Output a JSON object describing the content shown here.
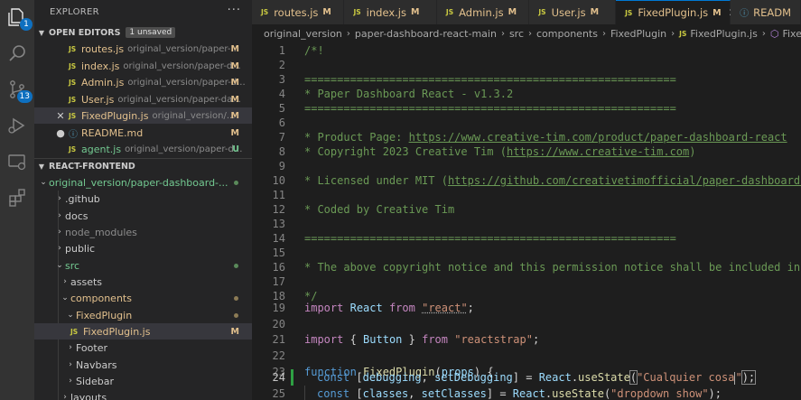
{
  "activity": {
    "scm_badge": "13",
    "explorer_badge": "1"
  },
  "sidebar": {
    "title": "EXPLORER",
    "more": "···",
    "open_editors": {
      "label": "OPEN EDITORS",
      "badge": "1 unsaved",
      "items": [
        {
          "name": "routes.js",
          "path": "original_version/paper-...",
          "status": "M",
          "type": "js"
        },
        {
          "name": "index.js",
          "path": "original_version/paper-d...",
          "status": "M",
          "type": "js"
        },
        {
          "name": "Admin.js",
          "path": "original_version/paper-d...",
          "status": "M",
          "type": "js"
        },
        {
          "name": "User.js",
          "path": "original_version/paper-da...",
          "status": "M",
          "type": "js"
        },
        {
          "name": "FixedPlugin.js",
          "path": "original_version/...",
          "status": "M",
          "type": "js"
        },
        {
          "name": "README.md",
          "path": "",
          "status": "M",
          "type": "info"
        },
        {
          "name": "agent.js",
          "path": "original_version/paper-d...",
          "status": "U",
          "type": "js"
        }
      ]
    },
    "project": {
      "label": "REACT-FRONTEND",
      "tree": [
        {
          "name": "original_version/paper-dashboard-...",
          "level": 0,
          "open": true
        },
        {
          "name": ".github",
          "level": 1,
          "open": false
        },
        {
          "name": "docs",
          "level": 1,
          "open": false
        },
        {
          "name": "node_modules",
          "level": 1,
          "open": false
        },
        {
          "name": "public",
          "level": 1,
          "open": false
        },
        {
          "name": "src",
          "level": 1,
          "open": true
        },
        {
          "name": "assets",
          "level": 2,
          "open": false
        },
        {
          "name": "components",
          "level": 2,
          "open": true
        },
        {
          "name": "FixedPlugin",
          "level": 3,
          "open": true
        },
        {
          "name": "FixedPlugin.js",
          "level": 4,
          "file": true,
          "status": "M"
        },
        {
          "name": "Footer",
          "level": 3,
          "open": false
        },
        {
          "name": "Navbars",
          "level": 3,
          "open": false
        },
        {
          "name": "Sidebar",
          "level": 3,
          "open": false
        },
        {
          "name": "layouts",
          "level": 2,
          "open": false
        }
      ]
    }
  },
  "tabs": [
    {
      "name": "routes.js",
      "mark": "M",
      "type": "js"
    },
    {
      "name": "index.js",
      "mark": "M",
      "type": "js"
    },
    {
      "name": "Admin.js",
      "mark": "M",
      "type": "js"
    },
    {
      "name": "User.js",
      "mark": "M",
      "type": "js"
    },
    {
      "name": "FixedPlugin.js",
      "mark": "M",
      "type": "js",
      "active": true
    },
    {
      "name": "READM",
      "mark": "",
      "type": "info"
    }
  ],
  "breadcrumb": [
    "original_version",
    "paper-dashboard-react-main",
    "src",
    "components",
    "FixedPlugin",
    "FixedPlugin.js",
    "FixedPlugin"
  ],
  "editor": {
    "line_numbers": [
      "1",
      "2",
      "3",
      "4",
      "5",
      "6",
      "7",
      "8",
      "9",
      "10",
      "11",
      "12",
      "13",
      "14",
      "15",
      "16",
      "17",
      "18",
      "19",
      "20",
      "21",
      "22",
      "23",
      "24",
      "25"
    ],
    "lines": {
      "l1": "/*!",
      "l3": "=========================================================",
      "l4": "* Paper Dashboard React - v1.3.2",
      "l5": "=========================================================",
      "l7a": "* Product Page: ",
      "l7b": "https://www.creative-tim.com/product/paper-dashboard-react",
      "l8a": "* Copyright 2023 Creative Tim (",
      "l8b": "https://www.creative-tim.com",
      "l8c": ")",
      "l10a": "* Licensed under MIT (",
      "l10b": "https://github.com/creativetimofficial/paper-dashboard-re",
      "l12": "* Coded by Creative Tim",
      "l14": "=========================================================",
      "l16": "* The above copyright notice and this permission notice shall be included in al",
      "l18": "*/",
      "l19": {
        "kw": "import",
        "id": "React",
        "from": "from",
        "str": "\"react\"",
        "end": ";"
      },
      "l21": {
        "kw": "import",
        "open": "{ ",
        "id": "Button",
        "close": " }",
        "from": "from",
        "str": "\"reactstrap\"",
        "end": ";"
      },
      "l23": {
        "kw": "function",
        "fn": "FixedPlugin",
        "open": "(",
        "param": "props",
        "close": ") {"
      },
      "l24": {
        "kw": "const",
        "a": "[",
        "v1": "debugging",
        "c": ", ",
        "v2": "setDebugging",
        "b": "] = ",
        "obj": "React",
        "dot": ".",
        "fn": "useState",
        "p1": "(",
        "str": "\"Cualquier cosa",
        "q": "\"",
        "p2": ");"
      },
      "l25": {
        "kw": "const",
        "a": "[",
        "v1": "classes",
        "c": ", ",
        "v2": "setClasses",
        "b": "] = ",
        "obj": "React",
        "dot": ".",
        "fn": "useState",
        "p1": "(",
        "str": "\"dropdown show\"",
        "p2": ");"
      }
    }
  }
}
